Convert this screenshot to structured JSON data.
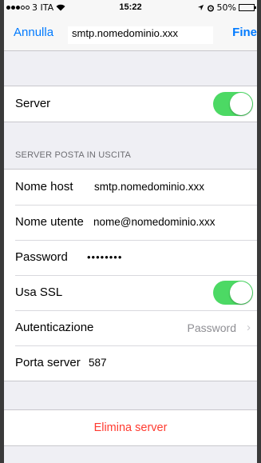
{
  "status_bar": {
    "carrier": "3 ITA",
    "time": "15:22",
    "battery_text": "50%",
    "battery_level": 0.5
  },
  "navbar": {
    "cancel_label": "Annulla",
    "title": "smtp.nomedominio.xxx",
    "done_label": "Fine",
    "accent_color": "#007aff"
  },
  "server_group": {
    "server_label": "Server",
    "server_enabled": true
  },
  "outgoing": {
    "section_header": "SERVER POSTA IN USCITA",
    "host_label": "Nome host",
    "host_value": "smtp.nomedominio.xxx",
    "user_label": "Nome utente",
    "user_value": "nome@nomedominio.xxx",
    "password_label": "Password",
    "password_value": "••••••••",
    "ssl_label": "Usa SSL",
    "ssl_enabled": true,
    "auth_label": "Autenticazione",
    "auth_value": "Password",
    "port_label": "Porta server",
    "port_value": "587"
  },
  "delete": {
    "label": "Elimina server",
    "color": "#ff3b30"
  },
  "colors": {
    "toggle_on": "#4cd964",
    "background": "#efeff4"
  }
}
